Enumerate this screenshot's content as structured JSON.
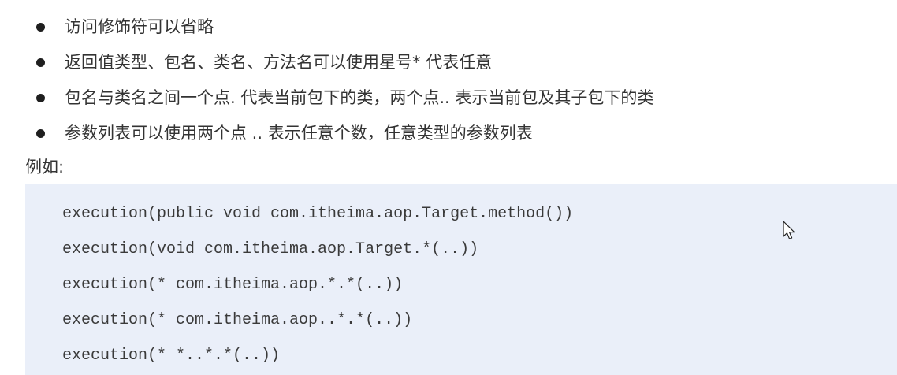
{
  "bullets": [
    {
      "text": "访问修饰符可以省略"
    },
    {
      "text": "返回值类型、包名、类名、方法名可以使用星号* 代表任意"
    },
    {
      "text": "包名与类名之间一个点. 代表当前包下的类，两个点.. 表示当前包及其子包下的类"
    },
    {
      "text": "参数列表可以使用两个点 .. 表示任意个数，任意类型的参数列表"
    }
  ],
  "example_label": "例如:",
  "code_lines": [
    "execution(public void com.itheima.aop.Target.method())",
    "execution(void com.itheima.aop.Target.*(..))",
    "execution(* com.itheima.aop.*.*(..))",
    "execution(* com.itheima.aop..*.*(..))",
    "execution(* *..*.*(..))"
  ],
  "icons": {
    "bullet": "bullet-dot-icon",
    "cursor": "mouse-pointer-icon"
  },
  "colors": {
    "code_background": "#eaeff9",
    "text": "#333333"
  }
}
